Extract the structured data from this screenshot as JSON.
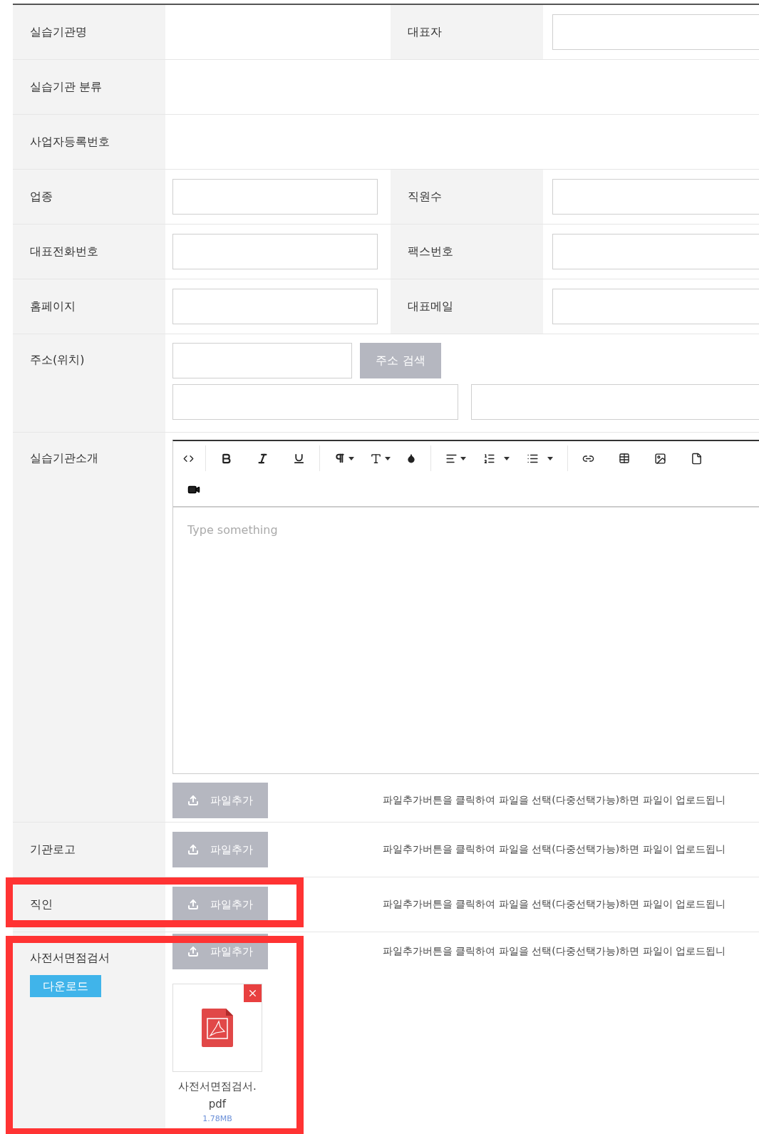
{
  "rows": [
    {
      "kind": "pair",
      "label": "실습기관명",
      "value_field": false,
      "right": {
        "label": "대표자"
      },
      "highlighted": false
    },
    {
      "kind": "plain",
      "label": "실습기관 분류",
      "highlighted": false
    },
    {
      "kind": "plain",
      "label": "사업자등록번호",
      "highlighted": false
    },
    {
      "kind": "pair",
      "label": "업종",
      "value_field": true,
      "right": {
        "label": "직원수"
      },
      "highlighted": false
    },
    {
      "kind": "pair",
      "label": "대표전화번호",
      "value_field": true,
      "right": {
        "label": "팩스번호"
      },
      "highlighted": false
    },
    {
      "kind": "pair",
      "label": "홈페이지",
      "value_field": true,
      "right": {
        "label": "대표메일"
      },
      "highlighted": false
    },
    {
      "kind": "address",
      "label": "주소(위치)",
      "button": "주소 검색",
      "highlighted": false
    },
    {
      "kind": "editor",
      "label": "실습기관소개",
      "placeholder": "Type something",
      "upload": {
        "button": "파일추가",
        "hint": "파일추가버튼을 클릭하여 파일을 선택(다중선택가능)하면 파일이 업로드됩니"
      },
      "highlighted": false
    },
    {
      "kind": "upload",
      "label": "기관로고",
      "upload": {
        "button": "파일추가",
        "hint": "파일추가버튼을 클릭하여 파일을 선택(다중선택가능)하면 파일이 업로드됩니"
      },
      "highlighted": false
    },
    {
      "kind": "upload",
      "label": "직인",
      "upload": {
        "button": "파일추가",
        "hint": "파일추가버튼을 클릭하여 파일을 선택(다중선택가능)하면 파일이 업로드됩니"
      },
      "highlighted": true
    },
    {
      "kind": "upload",
      "label": "사전서면점검서",
      "download": "다운로드",
      "upload": {
        "button": "파일추가",
        "hint": "파일추가버튼을 클릭하여 파일을 선택(다중선택가능)하면 파일이 업로드됩니"
      },
      "file": {
        "name": "사전서면점검서.pdf",
        "size": "1.78MB"
      },
      "highlighted": true
    }
  ]
}
